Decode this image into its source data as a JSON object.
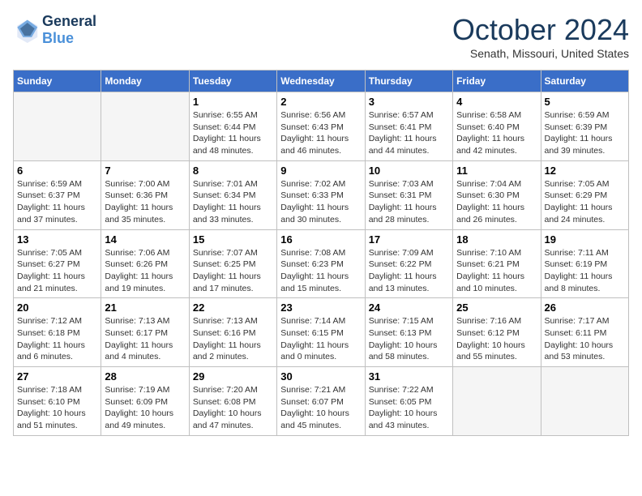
{
  "header": {
    "logo_line1": "General",
    "logo_line2": "Blue",
    "month_title": "October 2024",
    "subtitle": "Senath, Missouri, United States"
  },
  "days_of_week": [
    "Sunday",
    "Monday",
    "Tuesday",
    "Wednesday",
    "Thursday",
    "Friday",
    "Saturday"
  ],
  "weeks": [
    [
      {
        "day": "",
        "sunrise": "",
        "sunset": "",
        "daylight": ""
      },
      {
        "day": "",
        "sunrise": "",
        "sunset": "",
        "daylight": ""
      },
      {
        "day": "1",
        "sunrise": "Sunrise: 6:55 AM",
        "sunset": "Sunset: 6:44 PM",
        "daylight": "Daylight: 11 hours and 48 minutes."
      },
      {
        "day": "2",
        "sunrise": "Sunrise: 6:56 AM",
        "sunset": "Sunset: 6:43 PM",
        "daylight": "Daylight: 11 hours and 46 minutes."
      },
      {
        "day": "3",
        "sunrise": "Sunrise: 6:57 AM",
        "sunset": "Sunset: 6:41 PM",
        "daylight": "Daylight: 11 hours and 44 minutes."
      },
      {
        "day": "4",
        "sunrise": "Sunrise: 6:58 AM",
        "sunset": "Sunset: 6:40 PM",
        "daylight": "Daylight: 11 hours and 42 minutes."
      },
      {
        "day": "5",
        "sunrise": "Sunrise: 6:59 AM",
        "sunset": "Sunset: 6:39 PM",
        "daylight": "Daylight: 11 hours and 39 minutes."
      }
    ],
    [
      {
        "day": "6",
        "sunrise": "Sunrise: 6:59 AM",
        "sunset": "Sunset: 6:37 PM",
        "daylight": "Daylight: 11 hours and 37 minutes."
      },
      {
        "day": "7",
        "sunrise": "Sunrise: 7:00 AM",
        "sunset": "Sunset: 6:36 PM",
        "daylight": "Daylight: 11 hours and 35 minutes."
      },
      {
        "day": "8",
        "sunrise": "Sunrise: 7:01 AM",
        "sunset": "Sunset: 6:34 PM",
        "daylight": "Daylight: 11 hours and 33 minutes."
      },
      {
        "day": "9",
        "sunrise": "Sunrise: 7:02 AM",
        "sunset": "Sunset: 6:33 PM",
        "daylight": "Daylight: 11 hours and 30 minutes."
      },
      {
        "day": "10",
        "sunrise": "Sunrise: 7:03 AM",
        "sunset": "Sunset: 6:31 PM",
        "daylight": "Daylight: 11 hours and 28 minutes."
      },
      {
        "day": "11",
        "sunrise": "Sunrise: 7:04 AM",
        "sunset": "Sunset: 6:30 PM",
        "daylight": "Daylight: 11 hours and 26 minutes."
      },
      {
        "day": "12",
        "sunrise": "Sunrise: 7:05 AM",
        "sunset": "Sunset: 6:29 PM",
        "daylight": "Daylight: 11 hours and 24 minutes."
      }
    ],
    [
      {
        "day": "13",
        "sunrise": "Sunrise: 7:05 AM",
        "sunset": "Sunset: 6:27 PM",
        "daylight": "Daylight: 11 hours and 21 minutes."
      },
      {
        "day": "14",
        "sunrise": "Sunrise: 7:06 AM",
        "sunset": "Sunset: 6:26 PM",
        "daylight": "Daylight: 11 hours and 19 minutes."
      },
      {
        "day": "15",
        "sunrise": "Sunrise: 7:07 AM",
        "sunset": "Sunset: 6:25 PM",
        "daylight": "Daylight: 11 hours and 17 minutes."
      },
      {
        "day": "16",
        "sunrise": "Sunrise: 7:08 AM",
        "sunset": "Sunset: 6:23 PM",
        "daylight": "Daylight: 11 hours and 15 minutes."
      },
      {
        "day": "17",
        "sunrise": "Sunrise: 7:09 AM",
        "sunset": "Sunset: 6:22 PM",
        "daylight": "Daylight: 11 hours and 13 minutes."
      },
      {
        "day": "18",
        "sunrise": "Sunrise: 7:10 AM",
        "sunset": "Sunset: 6:21 PM",
        "daylight": "Daylight: 11 hours and 10 minutes."
      },
      {
        "day": "19",
        "sunrise": "Sunrise: 7:11 AM",
        "sunset": "Sunset: 6:19 PM",
        "daylight": "Daylight: 11 hours and 8 minutes."
      }
    ],
    [
      {
        "day": "20",
        "sunrise": "Sunrise: 7:12 AM",
        "sunset": "Sunset: 6:18 PM",
        "daylight": "Daylight: 11 hours and 6 minutes."
      },
      {
        "day": "21",
        "sunrise": "Sunrise: 7:13 AM",
        "sunset": "Sunset: 6:17 PM",
        "daylight": "Daylight: 11 hours and 4 minutes."
      },
      {
        "day": "22",
        "sunrise": "Sunrise: 7:13 AM",
        "sunset": "Sunset: 6:16 PM",
        "daylight": "Daylight: 11 hours and 2 minutes."
      },
      {
        "day": "23",
        "sunrise": "Sunrise: 7:14 AM",
        "sunset": "Sunset: 6:15 PM",
        "daylight": "Daylight: 11 hours and 0 minutes."
      },
      {
        "day": "24",
        "sunrise": "Sunrise: 7:15 AM",
        "sunset": "Sunset: 6:13 PM",
        "daylight": "Daylight: 10 hours and 58 minutes."
      },
      {
        "day": "25",
        "sunrise": "Sunrise: 7:16 AM",
        "sunset": "Sunset: 6:12 PM",
        "daylight": "Daylight: 10 hours and 55 minutes."
      },
      {
        "day": "26",
        "sunrise": "Sunrise: 7:17 AM",
        "sunset": "Sunset: 6:11 PM",
        "daylight": "Daylight: 10 hours and 53 minutes."
      }
    ],
    [
      {
        "day": "27",
        "sunrise": "Sunrise: 7:18 AM",
        "sunset": "Sunset: 6:10 PM",
        "daylight": "Daylight: 10 hours and 51 minutes."
      },
      {
        "day": "28",
        "sunrise": "Sunrise: 7:19 AM",
        "sunset": "Sunset: 6:09 PM",
        "daylight": "Daylight: 10 hours and 49 minutes."
      },
      {
        "day": "29",
        "sunrise": "Sunrise: 7:20 AM",
        "sunset": "Sunset: 6:08 PM",
        "daylight": "Daylight: 10 hours and 47 minutes."
      },
      {
        "day": "30",
        "sunrise": "Sunrise: 7:21 AM",
        "sunset": "Sunset: 6:07 PM",
        "daylight": "Daylight: 10 hours and 45 minutes."
      },
      {
        "day": "31",
        "sunrise": "Sunrise: 7:22 AM",
        "sunset": "Sunset: 6:05 PM",
        "daylight": "Daylight: 10 hours and 43 minutes."
      },
      {
        "day": "",
        "sunrise": "",
        "sunset": "",
        "daylight": ""
      },
      {
        "day": "",
        "sunrise": "",
        "sunset": "",
        "daylight": ""
      }
    ]
  ]
}
